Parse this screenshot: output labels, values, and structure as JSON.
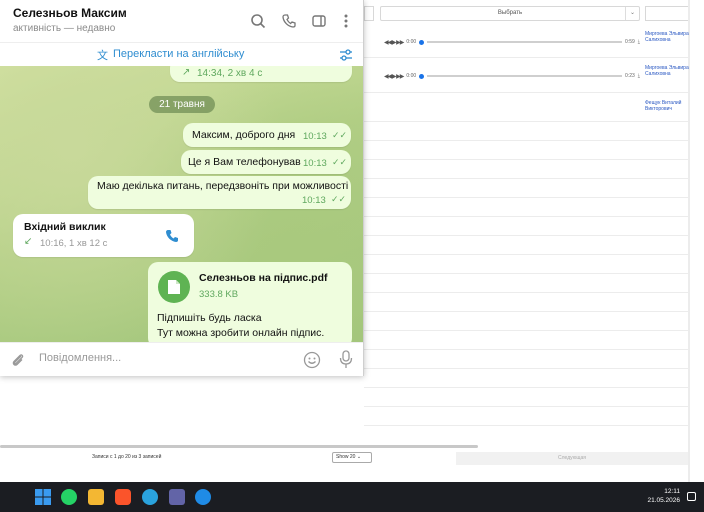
{
  "background_app": {
    "select_label": "Выбрать",
    "audio_rows": [
      {
        "start": "0:00",
        "end": "0:59"
      },
      {
        "start": "0:00",
        "end": "0:23"
      }
    ],
    "names": [
      "Миргоева Эльвира Салиховна",
      "Миргоева Эльвира Салиховна",
      "Фещук Виталий Викторович"
    ],
    "pagination_info": "Записи с 1 до 20 из 3 записей",
    "show_select": "Show 20",
    "next_button": "Следующая"
  },
  "telegram": {
    "contact_name": "Селезньов Максим",
    "contact_status": "активність — недавно",
    "translate_bar": "Перекласти на англійську",
    "top_partial_time": "14:34, 2 хв 4 с",
    "date_separator": "21 травня",
    "messages": [
      {
        "text": "Максим, доброго дня",
        "time": "10:13"
      },
      {
        "text": "Це я Вам телефонував",
        "time": "10:13"
      },
      {
        "text": "Маю декілька питань, передзвоніть при можливості",
        "time": "10:13"
      }
    ],
    "incoming_call": {
      "title": "Вхідний виклик",
      "meta": "10:16, 1 хв 12 с"
    },
    "file": {
      "name": "Селезньов на підпис.pdf",
      "size": "333.8 KB",
      "caption_line1": "Підпишіть будь ласка",
      "caption_line2": "Тут можна зробити онлайн підпис."
    },
    "compose_placeholder": "Повідомлення..."
  },
  "taskbar": {
    "time": "12:11",
    "date": "21.05.2026"
  }
}
